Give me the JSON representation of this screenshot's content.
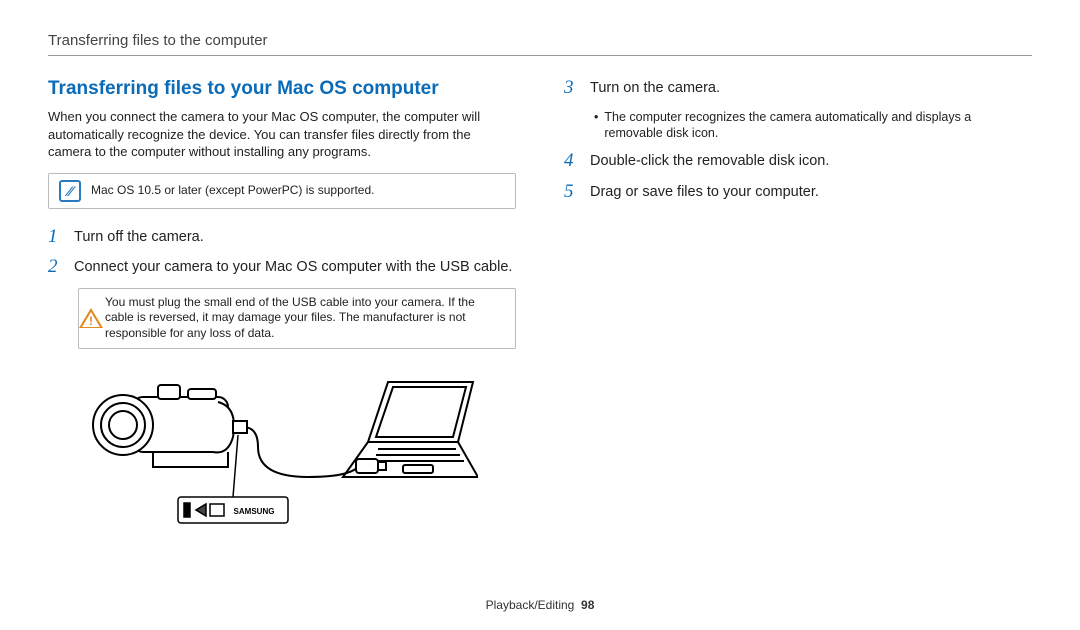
{
  "header": "Transferring files to the computer",
  "section_title": "Transferring files to your Mac OS computer",
  "intro_para": "When you connect the camera to your Mac OS computer, the computer will automatically recognize the device. You can transfer files directly from the camera to the computer without installing any programs.",
  "info_note": "Mac OS 10.5 or later (except PowerPC) is supported.",
  "steps_left": {
    "s1": {
      "num": "1",
      "text": "Turn off the camera."
    },
    "s2": {
      "num": "2",
      "text": "Connect your camera to your Mac OS computer with the USB cable."
    }
  },
  "warn_note": "You must plug the small end of the USB cable into your camera. If the cable is reversed, it may damage your files. The manufacturer is not responsible for any loss of data.",
  "steps_right": {
    "s3": {
      "num": "3",
      "text": "Turn on the camera."
    },
    "s3_sub": "The computer recognizes the camera automatically and displays a removable disk icon.",
    "s4": {
      "num": "4",
      "text": "Double-click the removable disk icon."
    },
    "s5": {
      "num": "5",
      "text": "Drag or save files to your computer."
    }
  },
  "illustration_label": "SAMSUNG",
  "footer": {
    "section": "Playback/Editing",
    "page": "98"
  }
}
